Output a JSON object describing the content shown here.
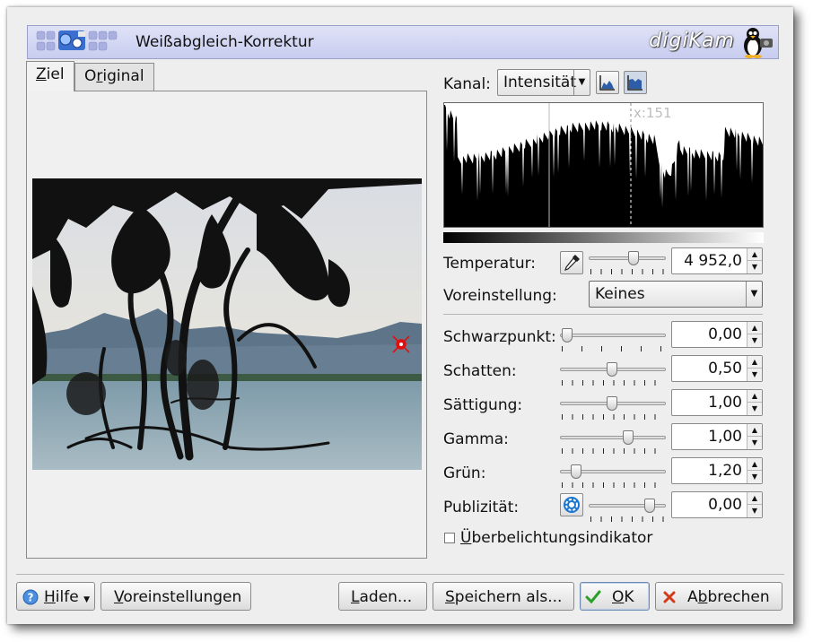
{
  "window": {
    "title": "Weißabgleich-Korrektur",
    "logo_text": "digiKam"
  },
  "tabs": [
    {
      "pre": "",
      "key": "Z",
      "post": "iel",
      "active": true
    },
    {
      "pre": "O",
      "key": "r",
      "post": "iginal",
      "active": false
    }
  ],
  "channel": {
    "label": "Kanal:",
    "value": "Intensität"
  },
  "histogram": {
    "cursor_label": "x:151"
  },
  "temperature": {
    "label": "Temperatur:",
    "value": "4 952,0"
  },
  "preset": {
    "label": "Voreinstellung:",
    "value": "Keines"
  },
  "params": [
    {
      "label": "Schwarzpunkt:",
      "value": "0,00"
    },
    {
      "label": "Schatten:",
      "value": "0,50"
    },
    {
      "label": "Sättigung:",
      "value": "1,00"
    },
    {
      "label": "Gamma:",
      "value": "1,00"
    },
    {
      "label": "Grün:",
      "value": "1,20"
    },
    {
      "label": "Publizität:",
      "value": "0,00"
    }
  ],
  "overexposure": {
    "key": "Ü",
    "post": "berbelichtungsindikator",
    "checked": false
  },
  "buttons": {
    "help": {
      "key": "H",
      "post": "ilfe"
    },
    "presets": {
      "key": "V",
      "post": "oreinstellungen"
    },
    "load": {
      "key": "L",
      "post": "aden..."
    },
    "save_as": {
      "key": "S",
      "post": "peichern als..."
    },
    "ok": {
      "key": "O",
      "post": "K"
    },
    "cancel": {
      "pre": "A",
      "key": "b",
      "post": "brechen"
    }
  },
  "colors": {
    "header_bg": "#c8cdf0",
    "ok_icon": "#2aa02a",
    "cancel_icon": "#d23a1a",
    "marker": "#e01010"
  }
}
